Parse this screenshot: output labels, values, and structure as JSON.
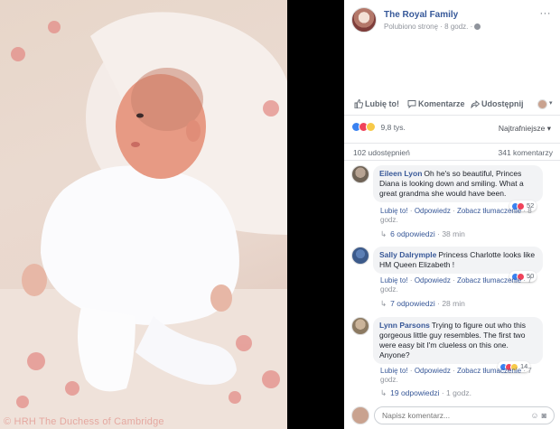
{
  "photo": {
    "credit": "© HRH The Duchess of Cambridge"
  },
  "post": {
    "page_name": "The Royal Family",
    "meta": "Polubiono stronę · 8 godz. ·",
    "more": "···"
  },
  "actions": {
    "like": "Lubię to!",
    "comment": "Komentarze",
    "share": "Udostępnij",
    "caret": "▾"
  },
  "summary": {
    "reactions_count": "9,8 tys.",
    "sort_label": "Najtrafniejsze ▾",
    "shares": "102 udostępnień",
    "comments": "341 komentarzy"
  },
  "comments": [
    {
      "author": "Eileen Lyon",
      "text": "Oh he's so beautiful, Princes Diana is looking down and smiling. What a great grandma she would have been.",
      "reactions": "52",
      "links": [
        "Lubię to!",
        "Odpowiedz",
        "Zobacz tłumaczenie",
        "8 godz."
      ],
      "replies": "6 odpowiedzi",
      "replies_time": "38 min"
    },
    {
      "author": "Sally Dalrymple",
      "text": "Princess Charlotte looks like HM Queen Elizabeth !",
      "reactions": "50",
      "links": [
        "Lubię to!",
        "Odpowiedz",
        "Zobacz tłumaczenie",
        "7 godz."
      ],
      "replies": "7 odpowiedzi",
      "replies_time": "28 min"
    },
    {
      "author": "Lynn Parsons",
      "text": "Trying to figure out who this gorgeous little guy resembles. The first two were easy bit I'm clueless on this one. Anyone?",
      "reactions": "14",
      "links": [
        "Lubię to!",
        "Odpowiedz",
        "Zobacz tłumaczenie",
        "7 godz."
      ],
      "replies": "19 odpowiedzi",
      "replies_time": "1 godz."
    }
  ],
  "compose": {
    "placeholder": "Napisz komentarz..."
  },
  "colors": {
    "link": "#385898",
    "brand": "#365899",
    "like": "#3b82f0",
    "love": "#f0435a",
    "haha": "#f7c948"
  }
}
